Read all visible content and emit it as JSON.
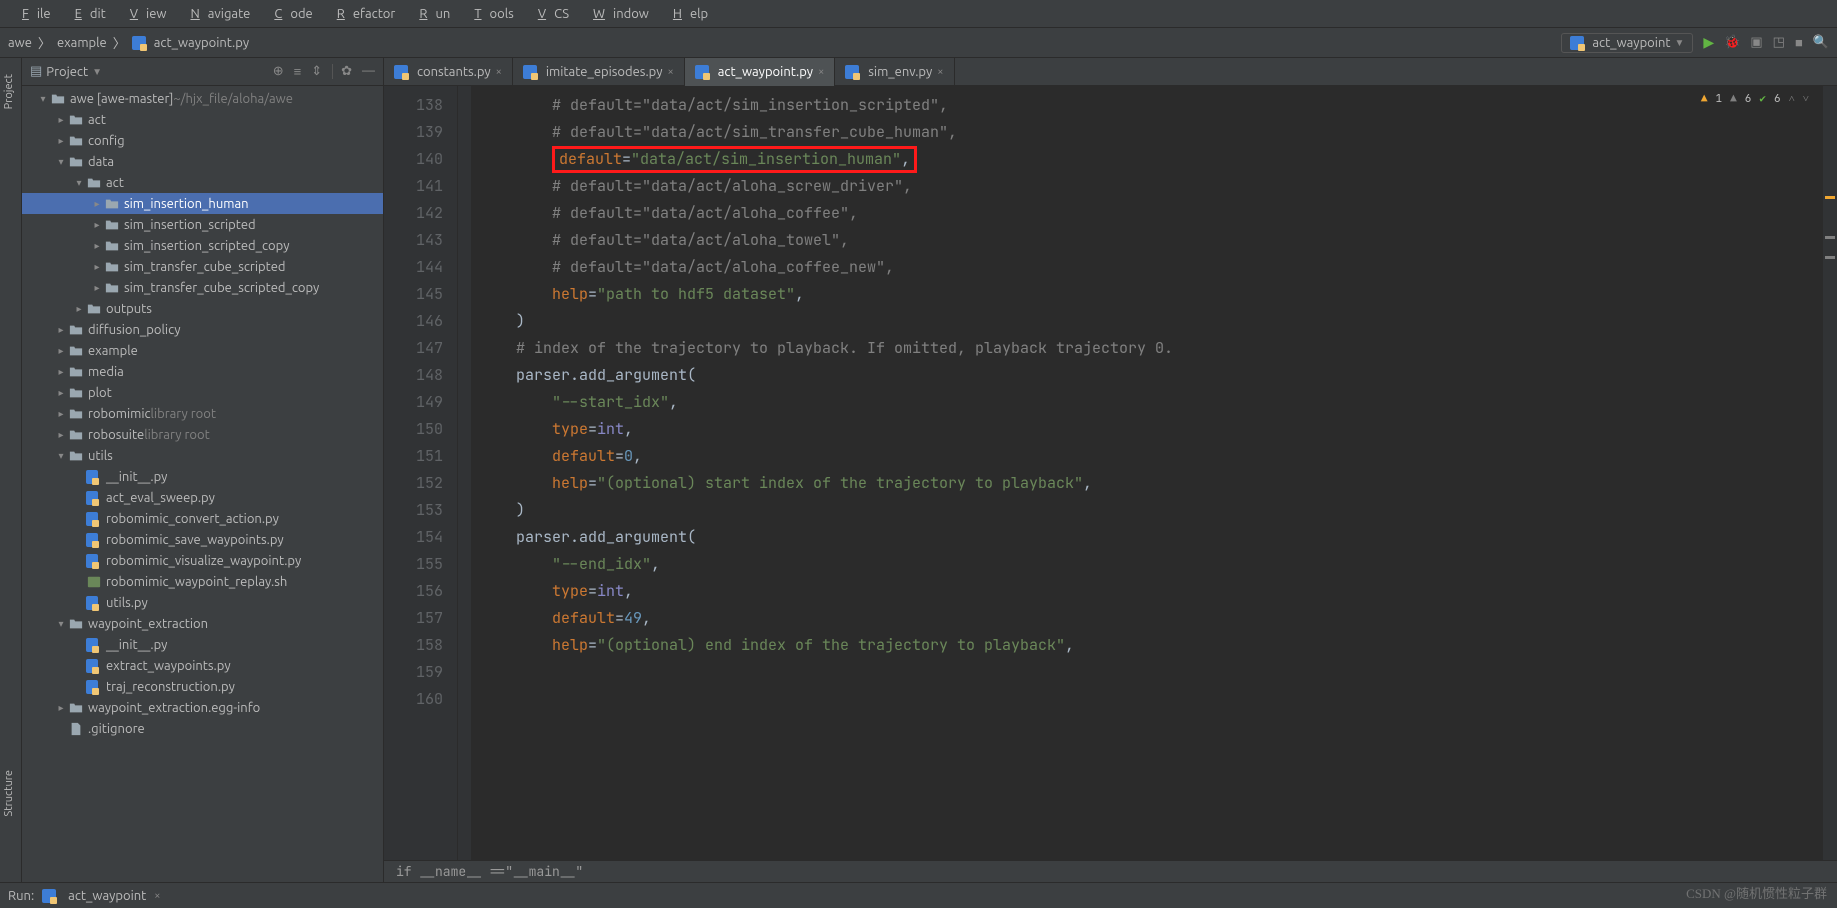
{
  "menu": [
    "File",
    "Edit",
    "View",
    "Navigate",
    "Code",
    "Refactor",
    "Run",
    "Tools",
    "VCS",
    "Window",
    "Help"
  ],
  "breadcrumb": [
    "awe",
    "example",
    "act_waypoint.py"
  ],
  "run_config": "act_waypoint",
  "panel": {
    "title": "Project"
  },
  "tree": [
    {
      "d": 0,
      "t": "awe [awe-master]",
      "hint": "~/hjx_file/aloha/awe",
      "exp": "▾",
      "icon": "folder"
    },
    {
      "d": 1,
      "t": "act",
      "exp": "▸",
      "icon": "folder"
    },
    {
      "d": 1,
      "t": "config",
      "exp": "▸",
      "icon": "folder"
    },
    {
      "d": 1,
      "t": "data",
      "exp": "▾",
      "icon": "folder"
    },
    {
      "d": 2,
      "t": "act",
      "exp": "▾",
      "icon": "folder"
    },
    {
      "d": 3,
      "t": "sim_insertion_human",
      "exp": "▸",
      "icon": "folder",
      "sel": true
    },
    {
      "d": 3,
      "t": "sim_insertion_scripted",
      "exp": "▸",
      "icon": "folder"
    },
    {
      "d": 3,
      "t": "sim_insertion_scripted_copy",
      "exp": "▸",
      "icon": "folder"
    },
    {
      "d": 3,
      "t": "sim_transfer_cube_scripted",
      "exp": "▸",
      "icon": "folder"
    },
    {
      "d": 3,
      "t": "sim_transfer_cube_scripted_copy",
      "exp": "▸",
      "icon": "folder"
    },
    {
      "d": 2,
      "t": "outputs",
      "exp": "▸",
      "icon": "folder"
    },
    {
      "d": 1,
      "t": "diffusion_policy",
      "exp": "▸",
      "icon": "folder"
    },
    {
      "d": 1,
      "t": "example",
      "exp": "▸",
      "icon": "folder"
    },
    {
      "d": 1,
      "t": "media",
      "exp": "▸",
      "icon": "folder"
    },
    {
      "d": 1,
      "t": "plot",
      "exp": "▸",
      "icon": "folder"
    },
    {
      "d": 1,
      "t": "robomimic",
      "hint": "library root",
      "exp": "▸",
      "icon": "folder"
    },
    {
      "d": 1,
      "t": "robosuite",
      "hint": "library root",
      "exp": "▸",
      "icon": "folder"
    },
    {
      "d": 1,
      "t": "utils",
      "exp": "▾",
      "icon": "folder"
    },
    {
      "d": 2,
      "t": "__init__.py",
      "exp": "",
      "icon": "py"
    },
    {
      "d": 2,
      "t": "act_eval_sweep.py",
      "exp": "",
      "icon": "py"
    },
    {
      "d": 2,
      "t": "robomimic_convert_action.py",
      "exp": "",
      "icon": "py"
    },
    {
      "d": 2,
      "t": "robomimic_save_waypoints.py",
      "exp": "",
      "icon": "py"
    },
    {
      "d": 2,
      "t": "robomimic_visualize_waypoint.py",
      "exp": "",
      "icon": "py"
    },
    {
      "d": 2,
      "t": "robomimic_waypoint_replay.sh",
      "exp": "",
      "icon": "sh"
    },
    {
      "d": 2,
      "t": "utils.py",
      "exp": "",
      "icon": "py"
    },
    {
      "d": 1,
      "t": "waypoint_extraction",
      "exp": "▾",
      "icon": "folder"
    },
    {
      "d": 2,
      "t": "__init__.py",
      "exp": "",
      "icon": "py"
    },
    {
      "d": 2,
      "t": "extract_waypoints.py",
      "exp": "",
      "icon": "py"
    },
    {
      "d": 2,
      "t": "traj_reconstruction.py",
      "exp": "",
      "icon": "py"
    },
    {
      "d": 1,
      "t": "waypoint_extraction.egg-info",
      "exp": "▸",
      "icon": "folder"
    },
    {
      "d": 1,
      "t": ".gitignore",
      "exp": "",
      "icon": "file"
    }
  ],
  "tabs": [
    {
      "label": "constants.py",
      "active": false
    },
    {
      "label": "imitate_episodes.py",
      "active": false
    },
    {
      "label": "act_waypoint.py",
      "active": true
    },
    {
      "label": "sim_env.py",
      "active": false
    }
  ],
  "inspection": {
    "warn": "1",
    "weak": "6",
    "ok": "6"
  },
  "line_start": 138,
  "code_lines": [
    {
      "n": 138,
      "seg": [
        {
          "c": "c-comment",
          "t": "        # default=\"data/act/sim_insertion_scripted\","
        }
      ]
    },
    {
      "n": 139,
      "seg": [
        {
          "c": "c-comment",
          "t": "        # default=\"data/act/sim_transfer_cube_human\","
        }
      ]
    },
    {
      "n": 140,
      "box": true,
      "seg": [
        {
          "c": "c-kw",
          "t": "        default"
        },
        {
          "c": "c-op",
          "t": "="
        },
        {
          "c": "c-str",
          "t": "\"data/act/sim_insertion_human\""
        },
        {
          "c": "c-op",
          "t": ","
        }
      ]
    },
    {
      "n": 141,
      "seg": [
        {
          "c": "c-comment",
          "t": "        # default=\"data/act/aloha_screw_driver\","
        }
      ]
    },
    {
      "n": 142,
      "seg": [
        {
          "c": "c-comment",
          "t": "        # default=\"data/act/aloha_coffee\","
        }
      ]
    },
    {
      "n": 143,
      "seg": [
        {
          "c": "c-comment",
          "t": "        # default=\"data/act/aloha_towel\","
        }
      ]
    },
    {
      "n": 144,
      "seg": [
        {
          "c": "c-comment",
          "t": "        # default=\"data/act/aloha_coffee_new\","
        }
      ]
    },
    {
      "n": 145,
      "seg": [
        {
          "c": "c-kw",
          "t": "        help"
        },
        {
          "c": "c-op",
          "t": "="
        },
        {
          "c": "c-str",
          "t": "\"path to hdf5 dataset\""
        },
        {
          "c": "c-op",
          "t": ","
        }
      ]
    },
    {
      "n": 146,
      "seg": [
        {
          "c": "c-op",
          "t": "    )"
        }
      ]
    },
    {
      "n": 147,
      "seg": [
        {
          "c": "c-op",
          "t": ""
        }
      ]
    },
    {
      "n": 148,
      "seg": [
        {
          "c": "c-comment",
          "t": "    # index of the trajectory to playback. If omitted, playback trajectory 0."
        }
      ]
    },
    {
      "n": 149,
      "seg": [
        {
          "c": "c-op",
          "t": "    parser.add_argument("
        }
      ]
    },
    {
      "n": 150,
      "seg": [
        {
          "c": "c-str",
          "t": "        \"--start_idx\""
        },
        {
          "c": "c-op",
          "t": ","
        }
      ]
    },
    {
      "n": 151,
      "seg": [
        {
          "c": "c-kw",
          "t": "        type"
        },
        {
          "c": "c-op",
          "t": "="
        },
        {
          "c": "c-builtin",
          "t": "int"
        },
        {
          "c": "c-op",
          "t": ","
        }
      ]
    },
    {
      "n": 152,
      "seg": [
        {
          "c": "c-kw",
          "t": "        default"
        },
        {
          "c": "c-op",
          "t": "="
        },
        {
          "c": "c-num",
          "t": "0"
        },
        {
          "c": "c-op",
          "t": ","
        }
      ]
    },
    {
      "n": 153,
      "seg": [
        {
          "c": "c-kw",
          "t": "        help"
        },
        {
          "c": "c-op",
          "t": "="
        },
        {
          "c": "c-str",
          "t": "\"(optional) start index of the trajectory to playback\""
        },
        {
          "c": "c-op",
          "t": ","
        }
      ]
    },
    {
      "n": 154,
      "seg": [
        {
          "c": "c-op",
          "t": "    )"
        }
      ]
    },
    {
      "n": 155,
      "seg": [
        {
          "c": "c-op",
          "t": ""
        }
      ]
    },
    {
      "n": 156,
      "seg": [
        {
          "c": "c-op",
          "t": "    parser.add_argument("
        }
      ]
    },
    {
      "n": 157,
      "seg": [
        {
          "c": "c-str",
          "t": "        \"--end_idx\""
        },
        {
          "c": "c-op",
          "t": ","
        }
      ]
    },
    {
      "n": 158,
      "seg": [
        {
          "c": "c-kw",
          "t": "        type"
        },
        {
          "c": "c-op",
          "t": "="
        },
        {
          "c": "c-builtin",
          "t": "int"
        },
        {
          "c": "c-op",
          "t": ","
        }
      ]
    },
    {
      "n": 159,
      "seg": [
        {
          "c": "c-kw",
          "t": "        default"
        },
        {
          "c": "c-op",
          "t": "="
        },
        {
          "c": "c-num",
          "t": "49"
        },
        {
          "c": "c-op",
          "t": ","
        }
      ]
    },
    {
      "n": 160,
      "seg": [
        {
          "c": "c-kw",
          "t": "        help"
        },
        {
          "c": "c-op",
          "t": "="
        },
        {
          "c": "c-str",
          "t": "\"(optional) end index of the trajectory to playback\""
        },
        {
          "c": "c-op",
          "t": ","
        }
      ]
    }
  ],
  "editor_crumb": "if __name__ ==\"__main__\"",
  "bottom": {
    "run": "Run:",
    "file": "act_waypoint"
  },
  "left_tabs": [
    "Project",
    "Structure"
  ],
  "watermark": "CSDN @随机惯性粒子群"
}
